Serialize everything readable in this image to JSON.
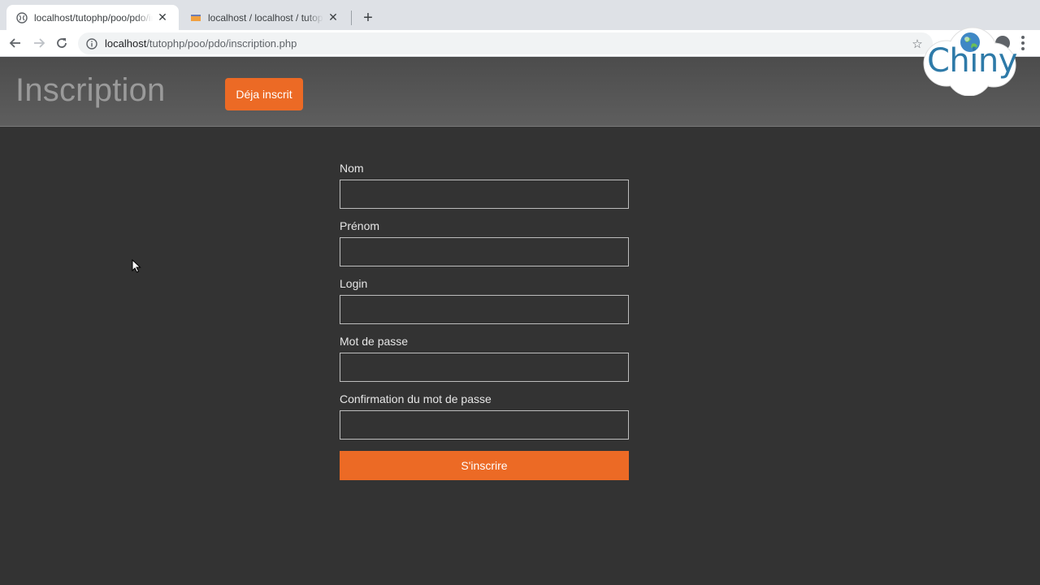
{
  "browser": {
    "tabs": [
      {
        "title": "localhost/tutophp/poo/pdo/inscription.php",
        "active": true,
        "favicon": "globe-icon"
      },
      {
        "title": "localhost / localhost / tutophp",
        "active": false,
        "favicon": "phpmyadmin-icon"
      }
    ],
    "url": {
      "host": "localhost",
      "path": "/tutophp/poo/pdo/inscription.php"
    }
  },
  "header": {
    "title": "Inscription",
    "already_button": "Déja inscrit"
  },
  "form": {
    "fields": [
      {
        "label": "Nom",
        "value": ""
      },
      {
        "label": "Prénom",
        "value": ""
      },
      {
        "label": "Login",
        "value": ""
      },
      {
        "label": "Mot de passe",
        "value": ""
      },
      {
        "label": "Confirmation du mot de passe",
        "value": ""
      }
    ],
    "submit_label": "S'inscrire"
  },
  "logo": {
    "text": "Chiny"
  },
  "colors": {
    "accent": "#ec6a25",
    "page_background": "#333333",
    "header_background": "#555555",
    "logo_blue": "#2e7aa8"
  }
}
